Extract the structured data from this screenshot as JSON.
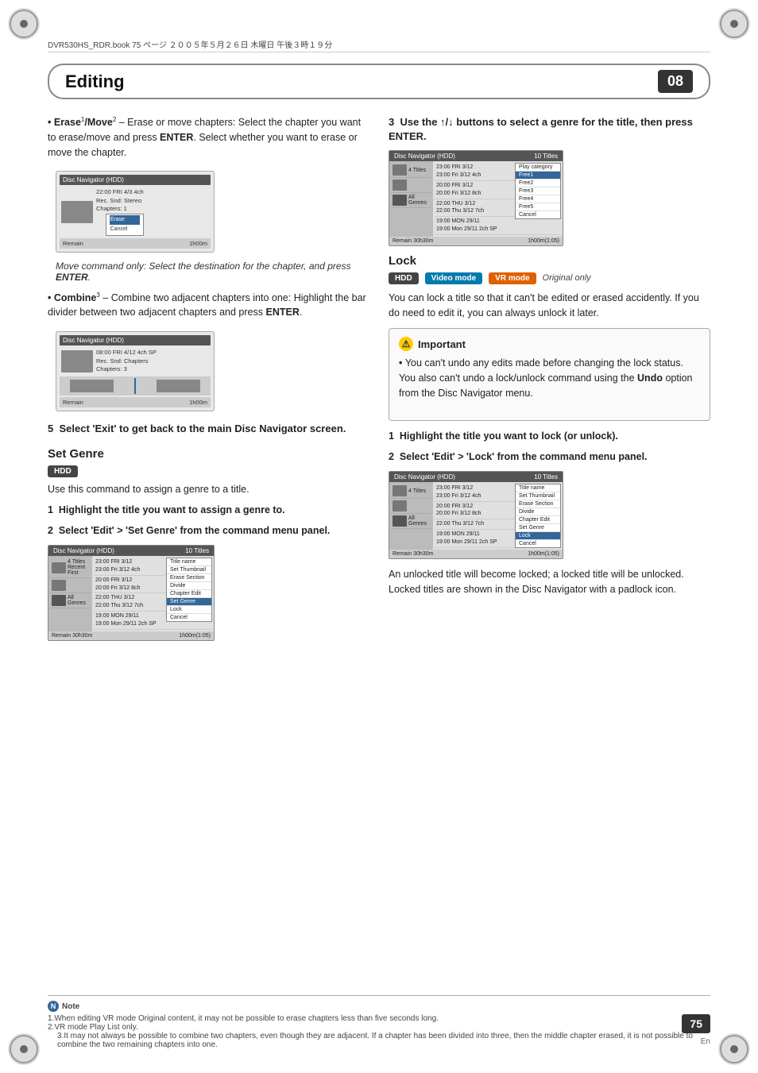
{
  "topbar": {
    "text": "DVR530HS_RDR.book  75 ページ  ２００５年５月２６日  木曜日  午後３時１９分"
  },
  "chapter": {
    "title": "Editing",
    "number": "08"
  },
  "left_col": {
    "erase_move_bullet": "Erase",
    "erase_move_sup": "1",
    "erase_move_text": "/Move",
    "erase_move_sup2": "2",
    "erase_move_desc": " – Erase or move chapters: Select the chapter you want to erase/move and press ",
    "erase_move_enter": "ENTER",
    "erase_move_desc2": ". Select whether you want to erase or move the chapter.",
    "move_italic": "Move command only:",
    "move_italic_desc": " Select the destination for the chapter, and press ",
    "move_italic_enter": "ENTER",
    "move_italic_end": ".",
    "combine_label": "Combine",
    "combine_sup": "3",
    "combine_desc": " – Combine two adjacent chapters into one: Highlight the bar divider between two adjacent chapters and press ",
    "combine_enter": "ENTER",
    "combine_end": ".",
    "step5_label": "5",
    "step5_text": "Select 'Exit' to get back to the main Disc Navigator screen.",
    "set_genre_heading": "Set Genre",
    "set_genre_hdd_badge": "HDD",
    "set_genre_desc": "Use this command to assign a genre to a title.",
    "step1_label": "1",
    "step1_text": "Highlight the title you want to assign a genre to.",
    "step2_label": "2",
    "step2_text": "Select 'Edit' > 'Set Genre' from the command menu panel."
  },
  "right_col": {
    "step3_label": "3",
    "step3_text": "Use the ↑/↓ buttons to select a genre for the title, then press ENTER.",
    "lock_heading": "Lock",
    "lock_hdd": "HDD",
    "lock_video": "Video mode",
    "lock_vr": "VR mode",
    "lock_original": "Original only",
    "lock_desc": "You can lock a title so that it can't be edited or erased accidently. If you do need to edit it, you can always unlock it later.",
    "important_heading": "Important",
    "important_bullet": "You can't undo any edits made before changing the lock status. You also can't undo a lock/unlock command using the ",
    "important_undo": "Undo",
    "important_end": " option from the Disc Navigator menu.",
    "lock_step1_label": "1",
    "lock_step1_text": "Highlight the title you want to lock (or unlock).",
    "lock_step2_label": "2",
    "lock_step2_text": "Select 'Edit' > 'Lock' from the command menu panel.",
    "lock_result": "An unlocked title will become locked; a locked title will be unlocked. Locked titles are shown in the Disc Navigator with a padlock icon."
  },
  "nav_screen_left": {
    "header_left": "Disc Navigator (HDD)",
    "header_right": "10 Titles",
    "sidebar_items": [
      {
        "label": "4 Titles",
        "sub": "Recent First"
      },
      {
        "label": ""
      },
      {
        "label": "All Genres"
      }
    ],
    "titles": [
      {
        "time": "23:00 FRI 3/12",
        "sub": "23:00 Fri 3/12 4ch"
      },
      {
        "time": "20:00 FRI 3/12",
        "sub": "20:00 Fri 3/12 8ch"
      },
      {
        "time": "22:00 THU 3/12",
        "sub": "22:00 Thu 3/12 7ch"
      },
      {
        "time": "19:00 MON 29/11",
        "sub": "19:00 Mon 29/11 2ch SP"
      }
    ],
    "menu_items": [
      "Title name",
      "Set Thumbnail",
      "Erase Section",
      "Divide",
      "Chapter Edit",
      "Set Genre",
      "Lock",
      "Cancel"
    ],
    "footer_left": "Remain 30h30m",
    "footer_right": "1h00m(1:05)"
  },
  "nav_screen_right": {
    "header_left": "Disc Navigator (HDD)",
    "header_right": "10 Titles",
    "menu_items_lock": [
      "Title name",
      "Set Thumbnail",
      "Erase Section",
      "Divide",
      "Chapter Edit",
      "Set Genre",
      "Lock",
      "Cancel"
    ],
    "footer_left": "Remain 30h30m",
    "footer_right": "1h00m(1:05)"
  },
  "notes": {
    "label": "Note",
    "note1": "1.When editing VR mode Original content, it may not be possible to erase chapters less than five seconds long.",
    "note2": "2.VR mode Play List only.",
    "note3": "3.It may not always be possible to combine two chapters, even though they are adjacent. If a chapter has been divided into three, then the middle chapter erased, it is not possible to combine the two remaining chapters into one."
  },
  "page": {
    "number": "75",
    "lang": "En"
  }
}
